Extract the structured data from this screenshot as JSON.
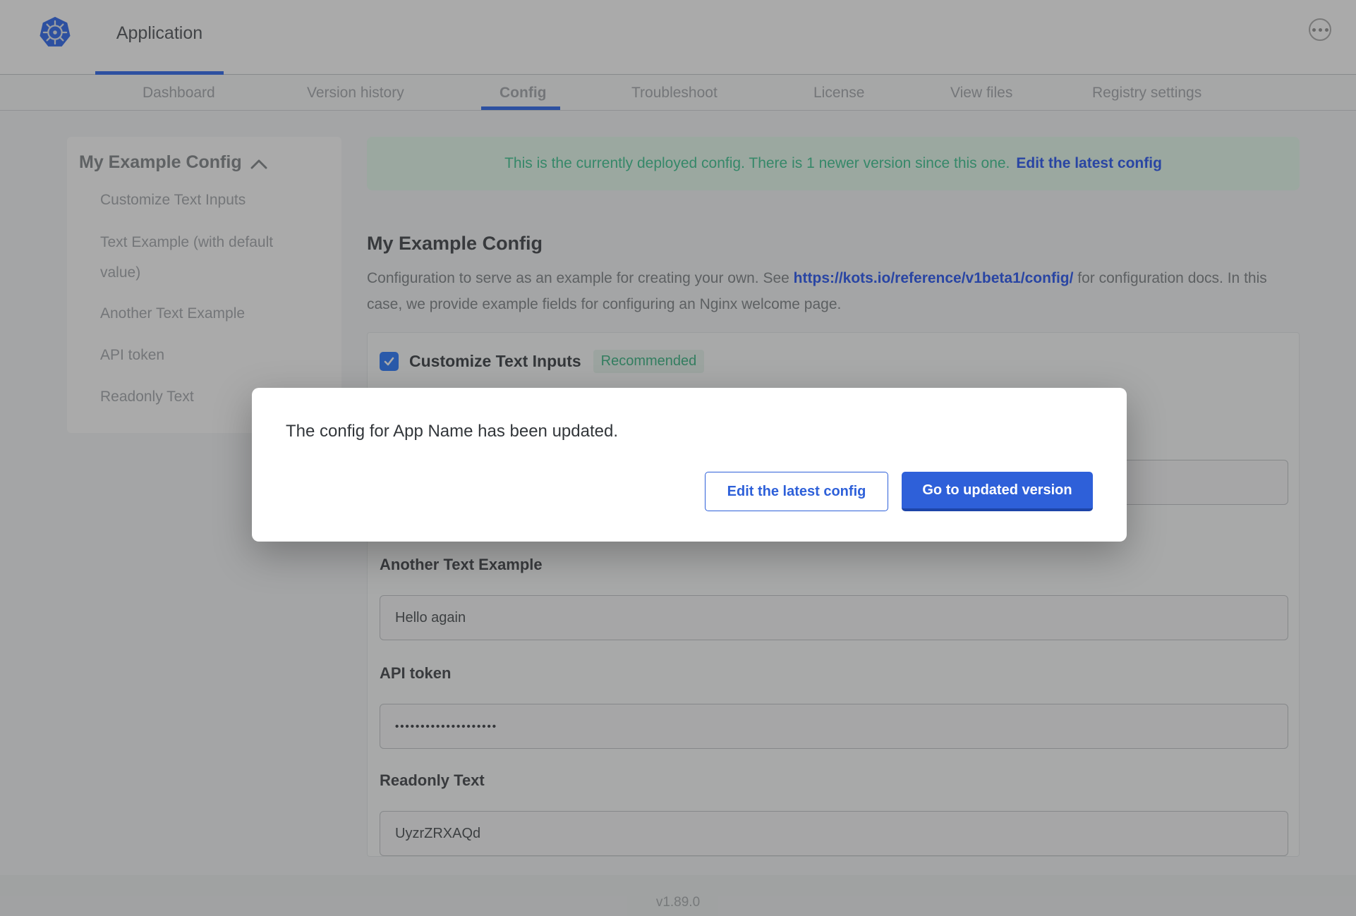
{
  "topbar": {
    "app_tab_label": "Application"
  },
  "nav": {
    "items": [
      {
        "label": "Dashboard"
      },
      {
        "label": "Version history"
      },
      {
        "label": "Config"
      },
      {
        "label": "Troubleshoot"
      },
      {
        "label": "License"
      },
      {
        "label": "View files"
      },
      {
        "label": "Registry settings"
      }
    ],
    "active": "Config"
  },
  "sidebar": {
    "title": "My Example Config",
    "items": [
      "Customize Text Inputs",
      "Text Example (with default value)",
      "Another Text Example",
      "API token",
      "Readonly Text"
    ]
  },
  "banner": {
    "message": "This is the currently deployed config. There is 1 newer version since this one.",
    "link_label": "Edit the latest config"
  },
  "config": {
    "title": "My Example Config",
    "description_before_link": "Configuration to serve as an example for creating your own. See ",
    "doc_link": "https://kots.io/reference/v1beta1/config/",
    "description_after_link": " for configuration docs. In this case, we provide example fields for configuring an Nginx welcome page.",
    "group": {
      "checkbox_label": "Customize Text Inputs",
      "badge_label": "Recommended",
      "checked": true
    },
    "fields": [
      {
        "label": "Another Text Example",
        "value": "Hello again"
      },
      {
        "label": "API token",
        "value": "••••••••••••••••••••"
      },
      {
        "label": "Readonly Text",
        "value": "UyzrZRXAQd"
      }
    ]
  },
  "modal": {
    "message": "The config for App Name has been updated.",
    "secondary_button_label": "Edit the latest config",
    "primary_button_label": "Go to updated version"
  },
  "footer": {
    "version": "v1.89.0"
  },
  "colors": {
    "accent_blue": "#4478f0",
    "primary_button_blue": "#2e60d9",
    "banner_text_green": "#52cc9e",
    "badge_green": "#4dbd90",
    "checkbox_blue": "#3f87ff"
  }
}
